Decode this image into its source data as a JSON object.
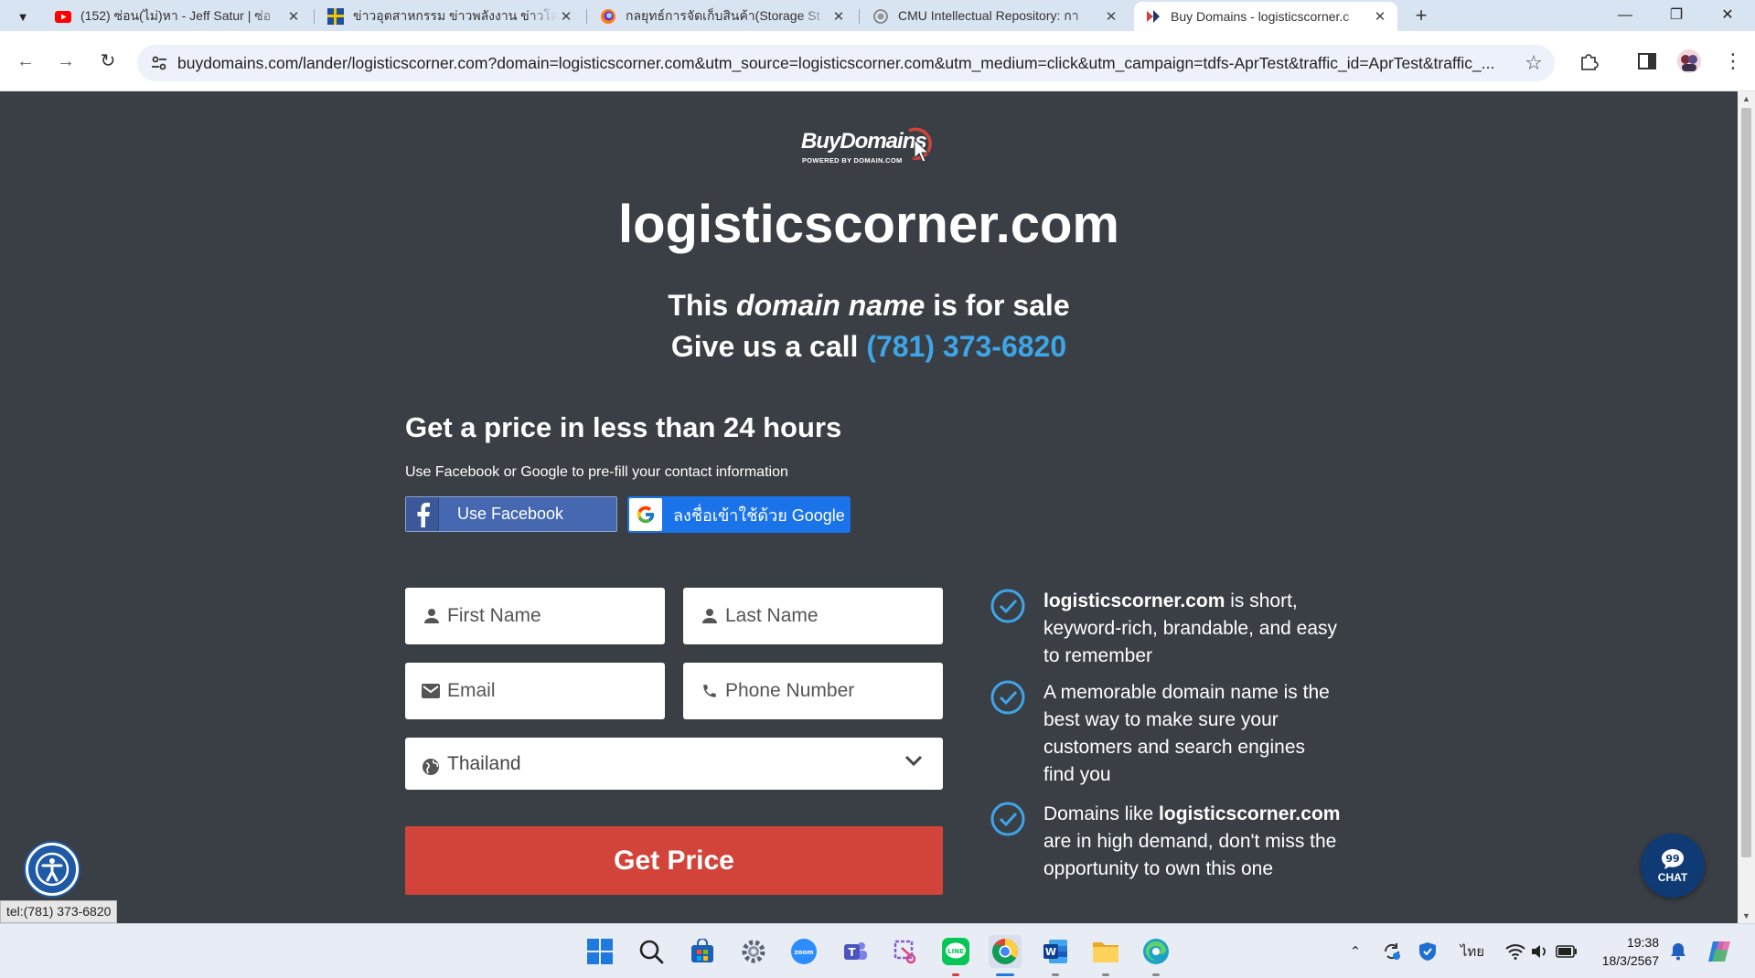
{
  "browser": {
    "tabs": [
      {
        "title": "(152) ซ่อน(ไม่)หา - Jeff Satur | ซ่อ",
        "favicon": "youtube-icon",
        "active": false
      },
      {
        "title": "ข่าวอุตสาหกรรม ข่าวพลังงาน ข่าวโล",
        "favicon": "news-icon",
        "active": false
      },
      {
        "title": "กลยุทธ์การจัดเก็บสินค้า(Storage St",
        "favicon": "firefox-icon",
        "active": false
      },
      {
        "title": "CMU Intellectual Repository: กา",
        "favicon": "repository-icon",
        "active": false
      },
      {
        "title": "Buy Domains - logisticscorner.c",
        "favicon": "buydomains-icon",
        "active": true
      }
    ],
    "url": "buydomains.com/lander/logisticscorner.com?domain=logisticscorner.com&utm_source=logisticscorner.com&utm_medium=click&utm_campaign=tdfs-AprTest&traffic_id=AprTest&traffic_..."
  },
  "logo": {
    "brand": "BuyDomains",
    "powered": "POWERED BY DOMAIN.COM"
  },
  "hero": {
    "domain": "logisticscorner.com",
    "sale_prefix": "This",
    "sale_emphasis": "domain name",
    "sale_suffix": "is for sale",
    "call_prefix": "Give us a call",
    "phone": "(781) 373-6820"
  },
  "form": {
    "heading": "Get a price in less than 24 hours",
    "prefill_note": "Use Facebook or Google to pre-fill your contact information",
    "facebook_label": "Use Facebook",
    "google_label": "ลงชื่อเข้าใช้ด้วย Google",
    "first_name_placeholder": "First Name",
    "last_name_placeholder": "Last Name",
    "email_placeholder": "Email",
    "phone_placeholder": "Phone Number",
    "country_value": "Thailand",
    "submit_label": "Get Price"
  },
  "benefits": [
    {
      "bold": "logisticscorner.com",
      "text": " is short, keyword-rich, brandable, and easy to remember"
    },
    {
      "pre": "A memorable domain name is the best way to make sure your customers and search engines find you"
    },
    {
      "pre": "Domains like ",
      "bold": "logisticscorner.com",
      "text": " are in high demand, don't miss the opportunity to own this one"
    }
  ],
  "widgets": {
    "chat_label": "CHAT",
    "status_link": "tel:(781) 373-6820"
  },
  "taskbar": {
    "language": "ไทย",
    "time": "19:38",
    "date": "18/3/2567"
  },
  "colors": {
    "page_bg": "#3a3f46",
    "accent_blue": "#3ea5e8",
    "submit_red": "#d2443a",
    "facebook_blue": "#4568b0",
    "google_blue": "#1a73e8"
  }
}
